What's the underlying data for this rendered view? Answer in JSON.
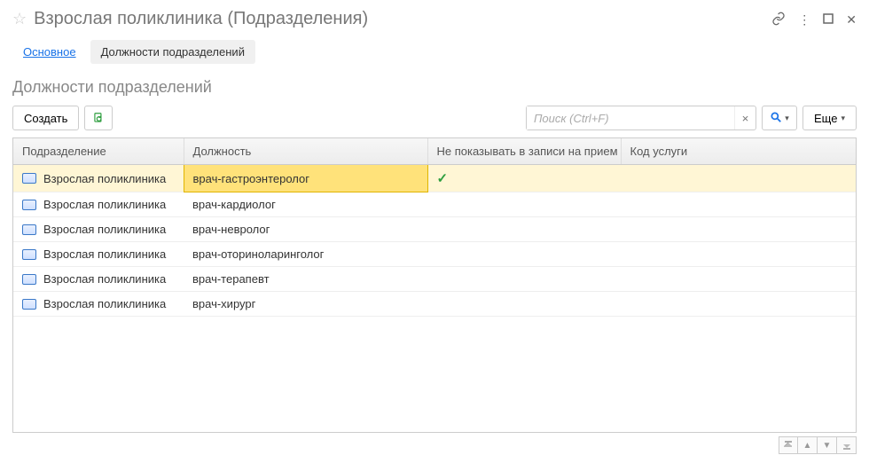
{
  "titlebar": {
    "title": "Взрослая поликлиника (Подразделения)"
  },
  "tabs": {
    "main": "Основное",
    "positions": "Должности подразделений"
  },
  "section_title": "Должности подразделений",
  "toolbar": {
    "create_label": "Создать",
    "more_label": "Еще"
  },
  "search": {
    "placeholder": "Поиск (Ctrl+F)"
  },
  "table": {
    "headers": {
      "department": "Подразделение",
      "position": "Должность",
      "hide": "Не показывать в записи на прием",
      "code": "Код услуги"
    },
    "rows": [
      {
        "department": "Взрослая поликлиника",
        "position": "врач-гастроэнтеролог",
        "hide": true,
        "code": "",
        "selected": true
      },
      {
        "department": "Взрослая поликлиника",
        "position": "врач-кардиолог",
        "hide": false,
        "code": "",
        "selected": false
      },
      {
        "department": "Взрослая поликлиника",
        "position": "врач-невролог",
        "hide": false,
        "code": "",
        "selected": false
      },
      {
        "department": "Взрослая поликлиника",
        "position": "врач-оториноларинголог",
        "hide": false,
        "code": "",
        "selected": false
      },
      {
        "department": "Взрослая поликлиника",
        "position": "врач-терапевт",
        "hide": false,
        "code": "",
        "selected": false
      },
      {
        "department": "Взрослая поликлиника",
        "position": "врач-хирург",
        "hide": false,
        "code": "",
        "selected": false
      }
    ]
  }
}
